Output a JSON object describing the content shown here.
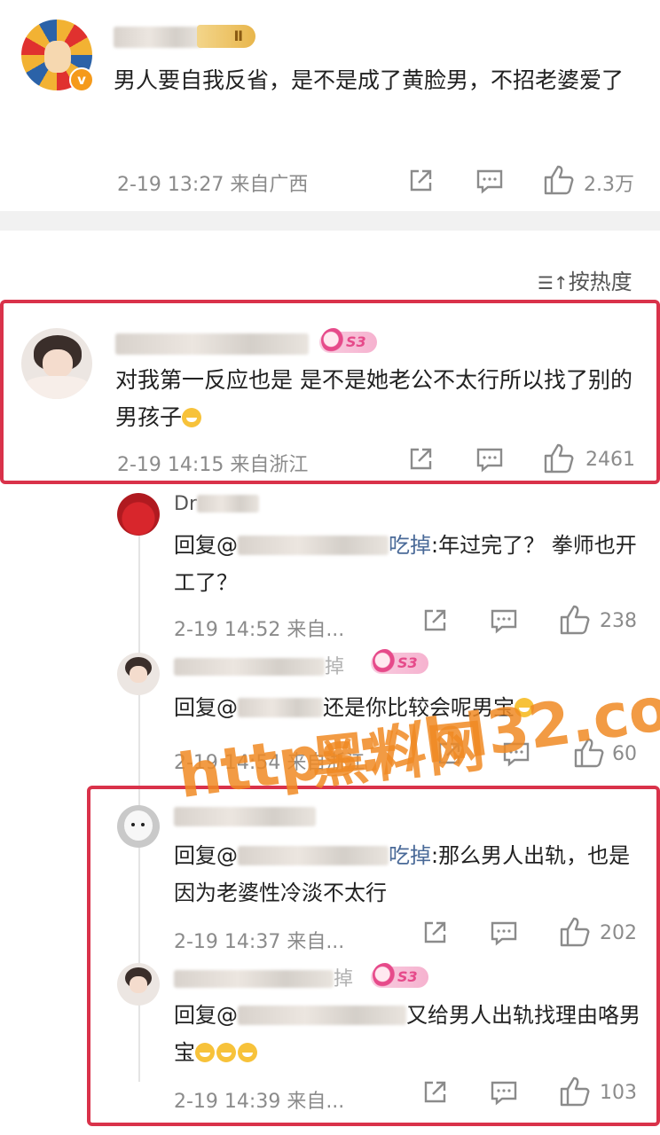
{
  "post": {
    "text": "男人要自我反省，是不是成了黄脸男，不招老婆爱了",
    "level_badge": "Ⅱ",
    "meta": "2-19 13:27 来自广西",
    "likes": "2.3万"
  },
  "sort_label": "按热度",
  "comment": {
    "badge": "S3",
    "text": "对我第一反应也是 是不是她老公不太行所以找了别的男孩子",
    "meta": "2-19 14:15 来自浙江",
    "likes": "2461"
  },
  "replies": [
    {
      "name_prefix": "Dr",
      "reply_prefix": "回复@",
      "mention_tail": "吃掉",
      "text": ":年过完了？ 拳师也开工了？",
      "meta": "2-19 14:52 来自...",
      "likes": "238"
    },
    {
      "name_tail": "掉",
      "badge": "S3",
      "reply_prefix": "回复@",
      "text": "还是你比较会呢男宝",
      "meta": "2-19 14:54 来自浙江",
      "likes": "60"
    },
    {
      "reply_prefix": "回复@",
      "mention_tail": "吃掉",
      "text": ":那么男人出轨，也是因为老婆性冷淡不太行",
      "meta": "2-19 14:37 来自...",
      "likes": "202"
    },
    {
      "name_tail": "掉",
      "badge": "S3",
      "reply_prefix": "回复@",
      "text": "又给男人出轨找理由咯男宝",
      "meta": "2-19 14:39 来自...",
      "likes": "103"
    }
  ],
  "watermark": {
    "line1": "黑料网",
    "line2": "https://hl32.co"
  },
  "colors": {
    "highlight_border": "#d9324a",
    "watermark": "#f08a24",
    "mention": "#4a6a98"
  }
}
